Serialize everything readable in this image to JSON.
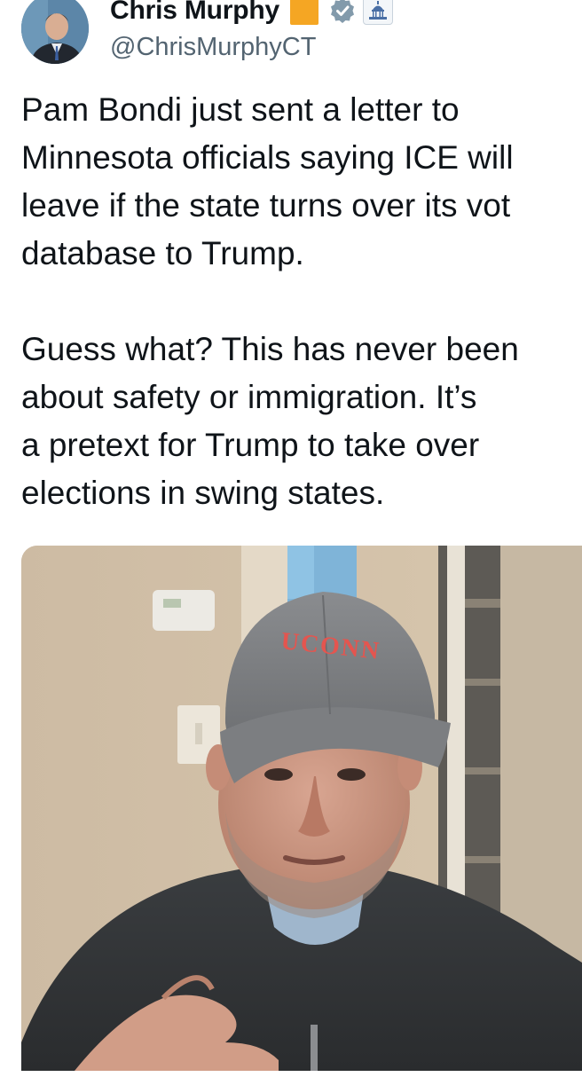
{
  "author": {
    "display_name": "Chris Murphy",
    "handle": "@ChrisMurphyCT",
    "badges": {
      "square_icon": "orange-square-icon",
      "square_color": "#f5a623",
      "verified_icon": "verified-badge-icon",
      "affiliation_icon": "capitol-building-icon"
    }
  },
  "tweet": {
    "paragraph1": [
      "Pam Bondi just sent a letter to",
      "Minnesota officials saying ICE will",
      "leave if the state turns over its vot",
      "database to Trump."
    ],
    "paragraph2": [
      "Guess what? This has never been",
      "about safety or immigration. It’s",
      "a pretext for Trump to take over",
      "elections in swing states."
    ]
  },
  "media": {
    "type": "video-thumbnail",
    "cap_text": "UCONN"
  },
  "colors": {
    "text": "#0f1419",
    "secondary_text": "#536471",
    "cap_text": "#e4554f"
  }
}
